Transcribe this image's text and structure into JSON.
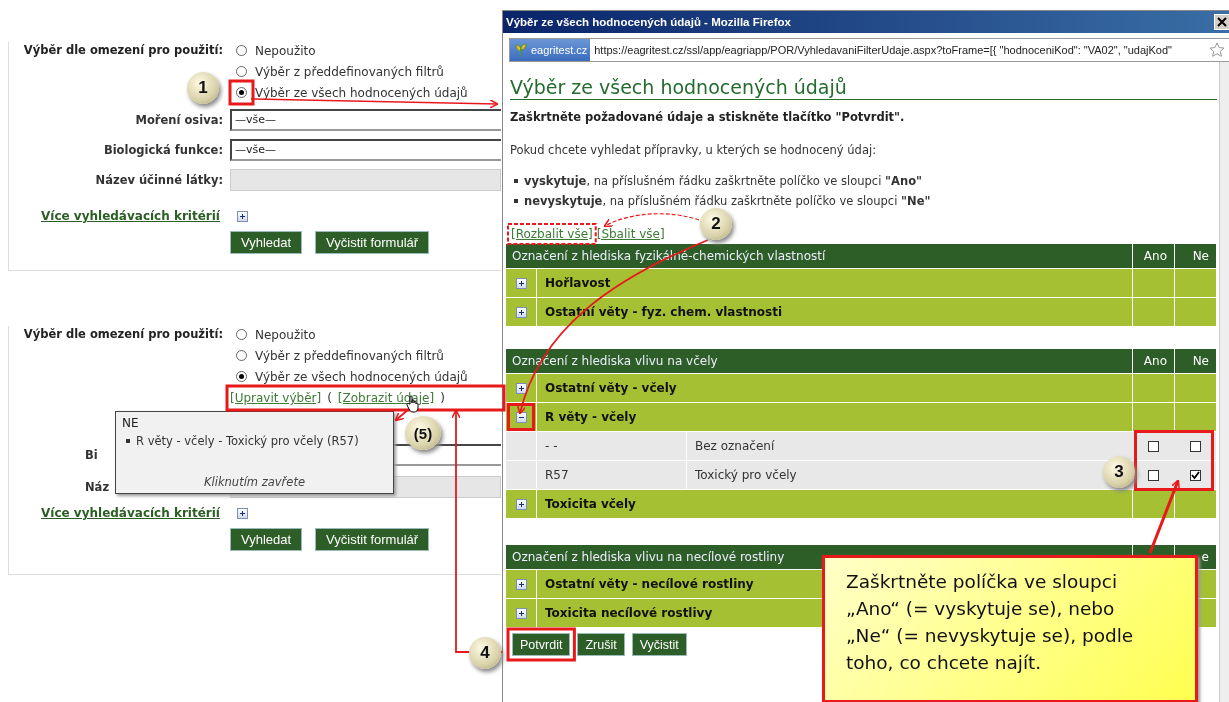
{
  "left_panels": [
    {
      "restriction_label": "Výběr dle omezení pro použití:",
      "options": [
        {
          "label": "Nepoužito",
          "selected": false
        },
        {
          "label": "Výběr z předdefinovaných filtrů",
          "selected": false
        },
        {
          "label": "Výběr ze všech hodnocených údajů",
          "selected": true
        }
      ],
      "fields": [
        {
          "label": "Moření osiva:",
          "value": "—vše—",
          "disabled": false
        },
        {
          "label": "Biologická funkce:",
          "value": "—vše—",
          "disabled": false
        },
        {
          "label": "Název účinné látky:",
          "disabled": true
        }
      ],
      "more_link": "Více vyhledávacích kritérií",
      "buttons": [
        "Vyhledat",
        "Vyčistit formulář"
      ]
    },
    {
      "restriction_label": "Výběr dle omezení pro použití:",
      "options": [
        {
          "label": "Nepoužito",
          "selected": false
        },
        {
          "label": "Výběr z předdefinovaných filtrů",
          "selected": false
        },
        {
          "label": "Výběr ze všech hodnocených údajů",
          "selected": true
        }
      ],
      "selection_links": [
        {
          "kind": "link",
          "text": "[Upravit výběr]"
        },
        {
          "kind": "text",
          "text": "("
        },
        {
          "kind": "link",
          "text": "[Zobrazit údaje]"
        },
        {
          "kind": "text",
          "text": ")"
        }
      ],
      "fields": [
        {
          "label": "Bi",
          "disabled": false
        },
        {
          "label": "Náz",
          "disabled": true
        }
      ],
      "tooltip": {
        "title": "NE",
        "items": [
          "R věty - včely - Toxický pro včely (R57)"
        ],
        "footer": "Kliknutím zavřete"
      },
      "more_link": "Více vyhledávacích kritérií",
      "buttons": [
        "Vyhledat",
        "Vyčistit formulář"
      ]
    }
  ],
  "popup": {
    "title": "Výběr ze všech hodnocených údajů - Mozilla Firefox",
    "site": "eagritest.cz",
    "url": "https://eagritest.cz/ssl/app/eagriapp/POR/VyhledavaniFilterUdaje.aspx?toFrame=[{ \"hodnoceniKod\": \"VA02\", \"udajKod\"",
    "heading": "Výběr ze všech hodnocených údajů",
    "instruction": "Zaškrtněte požadované údaje a stiskněte tlačítko \"Potvrdit\".",
    "intro": "Pokud chcete vyhledat přípravky, u kterých se hodnocený údaj:",
    "bullets": [
      "**vyskytuje**, na příslušném řádku zaškrtněte políčko ve sloupci **\"Ano\"**",
      "**nevyskytuje**, na příslušném řádku zaškrtněte políčko ve sloupci **\"Ne\"**"
    ],
    "links": [
      "[Rozbalit vše]",
      "[Sbalit vše]"
    ],
    "sections": [
      {
        "header": "Označení z hlediska fyzikálně-chemických vlastností",
        "col_ano": "Ano",
        "col_ne": "Ne",
        "groups": [
          {
            "label": "Hořlavost",
            "expanded": false
          },
          {
            "label": "Ostatní věty - fyz. chem. vlastnosti",
            "expanded": false
          }
        ]
      },
      {
        "header": "Označení z hlediska vlivu na včely",
        "col_ano": "Ano",
        "col_ne": "Ne",
        "groups": [
          {
            "label": "Ostatní věty - včely",
            "expanded": false
          },
          {
            "label": "R věty - včely",
            "expanded": true,
            "children": [
              {
                "code": "- -",
                "name": "Bez označení",
                "ano": false,
                "ne": false
              },
              {
                "code": "R57",
                "name": "Toxický pro včely",
                "ano": false,
                "ne": true
              }
            ]
          },
          {
            "label": "Toxicita včely",
            "expanded": false
          }
        ]
      },
      {
        "header": "Označení z hlediska vlivu na necílové rostliny",
        "col_ne": "e",
        "groups": [
          {
            "label": "Ostatní věty - necílové rostliny",
            "expanded": false
          },
          {
            "label": "Toxicita necílové rostlivy",
            "expanded": false
          }
        ]
      }
    ],
    "buttons": [
      "Potvrdit",
      "Zrušit",
      "Vyčistit"
    ]
  },
  "callouts": [
    "1",
    "2",
    "3",
    "4",
    "(5)"
  ],
  "note": "Zaškrtněte políčka ve sloupci „Ano“ (= vyskytuje se), nebo „Ne“ (= nevyskytuje se), podle toho, co chcete najít."
}
